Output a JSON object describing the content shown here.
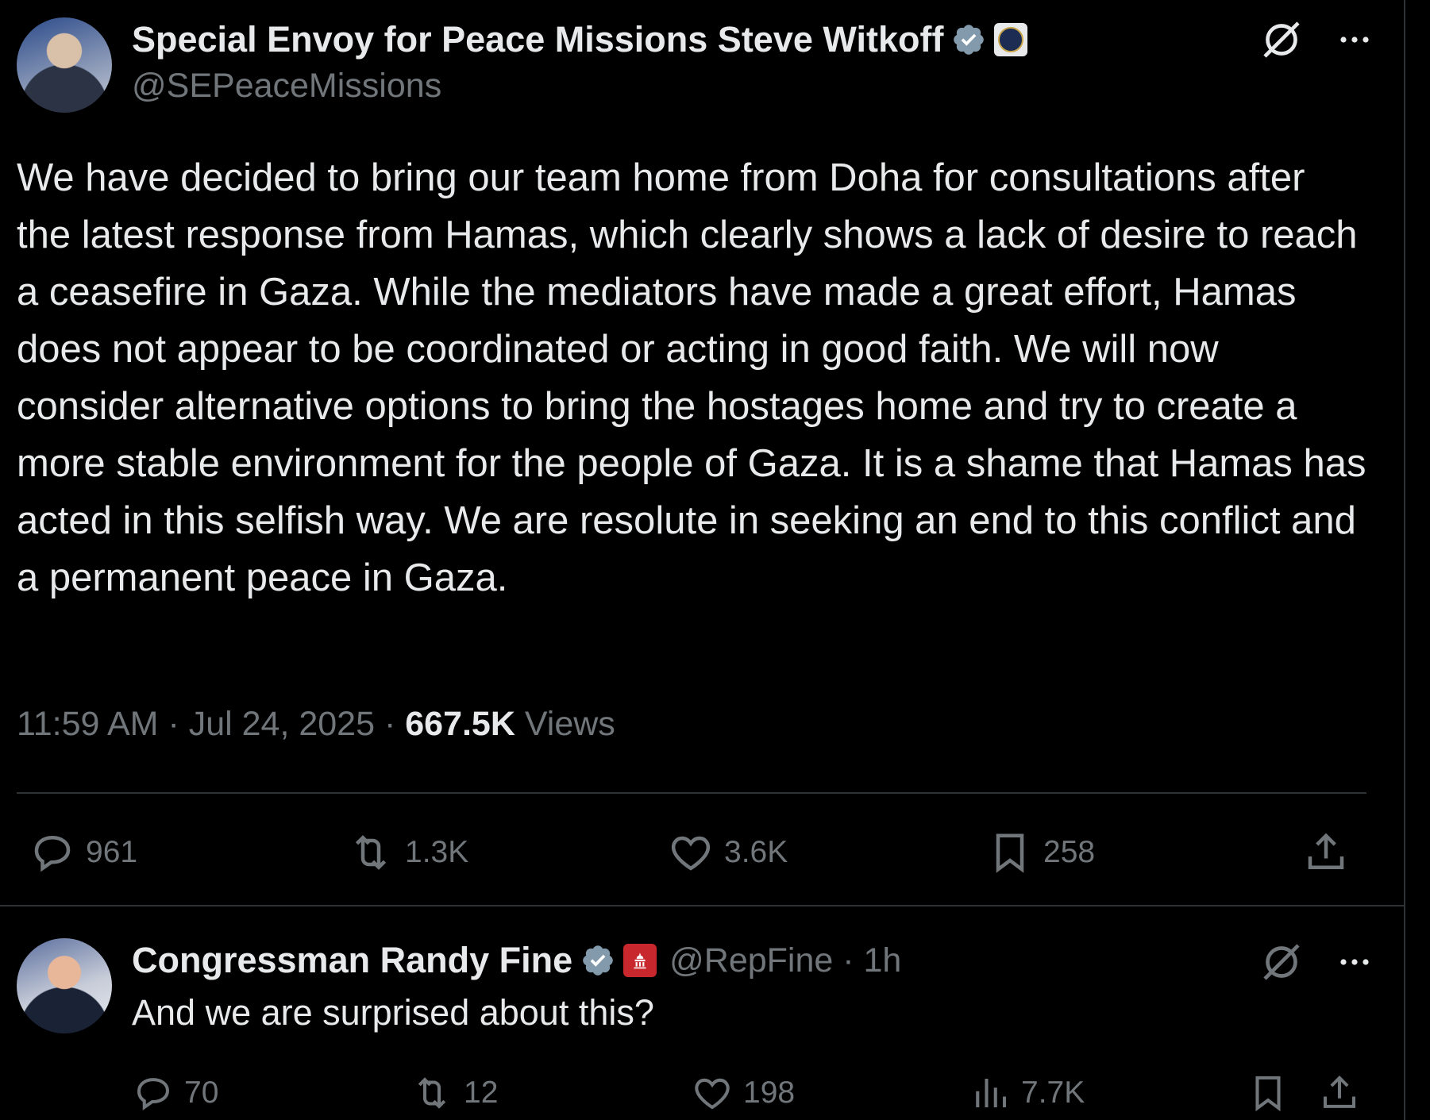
{
  "main_tweet": {
    "display_name": "Special Envoy for Peace Missions Steve Witkoff",
    "handle": "@SEPeaceMissions",
    "text": "We have decided to bring our team home from Doha for consultations after the latest response from Hamas, which clearly shows a lack of desire to reach a ceasefire in Gaza. While the mediators have made a great effort, Hamas does not appear to be coordinated or acting in good faith. We will now consider alternative options to bring the hostages home and try to create a more stable environment for the people of Gaza. It is a shame that Hamas has acted in this selfish way. We are resolute in seeking an end to this conflict and a permanent peace in Gaza.",
    "time": "11:59 AM",
    "separator": " · ",
    "date": "Jul 24, 2025",
    "views_count": "667.5K",
    "views_label": "Views",
    "actions": {
      "replies": "961",
      "reposts": "1.3K",
      "likes": "3.6K",
      "bookmarks": "258"
    },
    "icons": [
      "grok-icon",
      "more-icon",
      "verified-icon",
      "affiliation-seal-icon",
      "reply-icon",
      "repost-icon",
      "like-icon",
      "bookmark-icon",
      "share-icon"
    ]
  },
  "reply_tweet": {
    "display_name": "Congressman Randy Fine",
    "handle_time": "@RepFine · 1h",
    "text": "And we are surprised about this?",
    "actions": {
      "replies": "70",
      "reposts": "12",
      "likes": "198",
      "views": "7.7K"
    },
    "icons": [
      "grok-icon",
      "more-icon",
      "verified-icon",
      "capitol-badge-icon",
      "reply-icon",
      "repost-icon",
      "like-icon",
      "views-icon",
      "bookmark-icon",
      "share-icon"
    ]
  },
  "colors": {
    "background": "#000000",
    "text": "#e7e9ea",
    "secondary": "#71767b",
    "divider": "#2f3336",
    "verified": "#829aab"
  }
}
